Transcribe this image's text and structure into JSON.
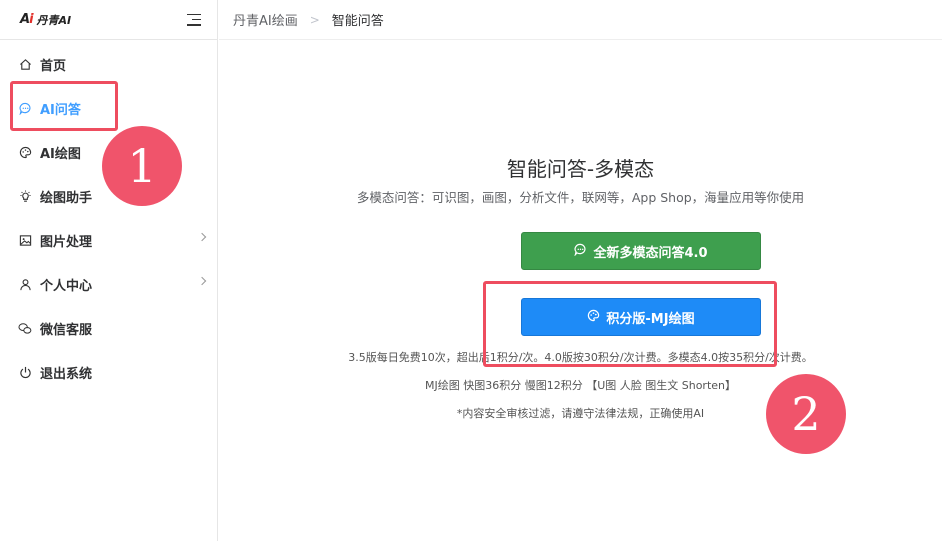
{
  "app": {
    "logo_text": "丹青AI"
  },
  "sidebar": {
    "items": [
      {
        "label": "首页",
        "icon": "home-icon",
        "active": false
      },
      {
        "label": "AI问答",
        "icon": "chat-bubble-icon",
        "active": true
      },
      {
        "label": "AI绘图",
        "icon": "palette-icon",
        "active": false
      },
      {
        "label": "绘图助手",
        "icon": "lightbulb-icon",
        "active": false
      },
      {
        "label": "图片处理",
        "icon": "image-icon",
        "active": false,
        "has_submenu": true
      },
      {
        "label": "个人中心",
        "icon": "user-icon",
        "active": false,
        "has_submenu": true
      },
      {
        "label": "微信客服",
        "icon": "wechat-icon",
        "active": false
      },
      {
        "label": "退出系统",
        "icon": "power-icon",
        "active": false
      }
    ]
  },
  "breadcrumb": {
    "root": "丹青AI绘画",
    "separator": ">",
    "current": "智能问答"
  },
  "main": {
    "title": "智能问答-多模态",
    "subtitle": "多模态问答：可识图，画图，分析文件，联网等，App Shop，海量应用等你使用",
    "primary_button": "全新多模态问答4.0",
    "secondary_button": "积分版-MJ绘图",
    "notes": [
      "3.5版每日免费10次，超出后1积分/次。4.0版按30积分/次计费。多模态4.0按35积分/次计费。",
      "MJ绘图 快图36积分 慢图12积分 【U图 人脸 图生文 Shorten】",
      "*内容安全审核过滤，请遵守法律法规，正确使用AI"
    ]
  },
  "annotations": {
    "badge_1": "1",
    "badge_2": "2"
  },
  "colors": {
    "accent": "#409eff",
    "green_button": "#3e9f4e",
    "blue_button": "#1e8bf7",
    "annotation_red": "#ee4d5f"
  }
}
